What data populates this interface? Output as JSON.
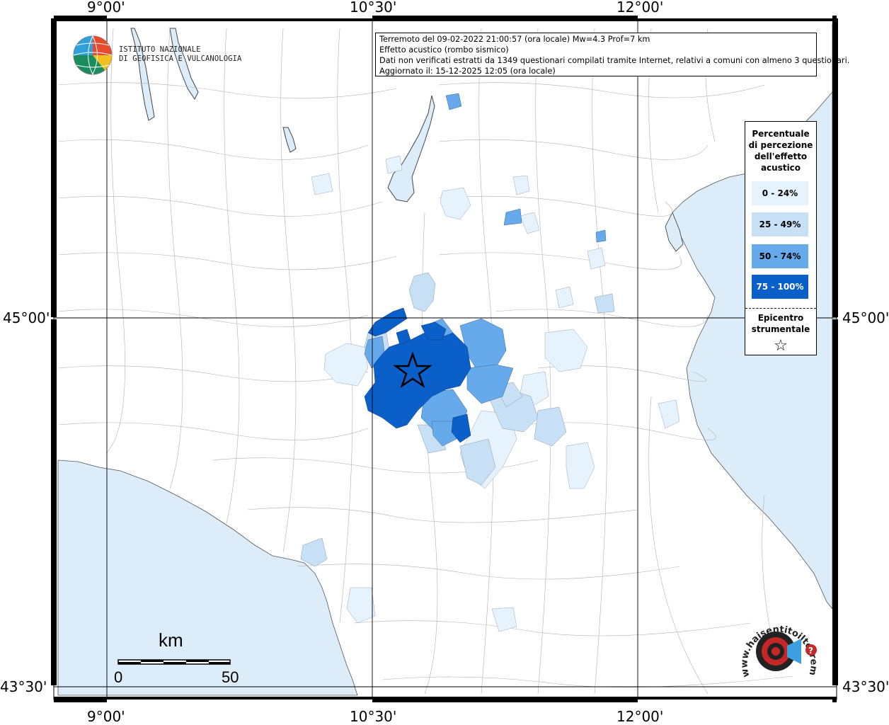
{
  "header": {
    "line1": "Terremoto del 09-02-2022 21:00:57 (ora locale) Mw=4.3 Prof=7 km",
    "line2": "Effetto acustico (rombo sismico)",
    "line3": "Dati non verificati estratti da 1349 questionari compilati tramite Internet, relativi a comuni con almeno 3 questionari.",
    "line4": "Aggiornato il: 15-12-2025 12:05 (ora locale)"
  },
  "logo": {
    "line1": "ISTITUTO NAZIONALE",
    "line2": "DI GEOFISICA E VULCANOLOGIA"
  },
  "axes": {
    "lon_top": [
      "9°00'",
      "10°30'",
      "12°00'"
    ],
    "lon_bottom": [
      "9°00'",
      "10°30'",
      "12°00'"
    ],
    "lat_left": [
      "45°00'",
      "43°30'"
    ],
    "lat_right": [
      "45°00'",
      "43°30'"
    ]
  },
  "legend": {
    "title": "Percentuale di percezione dell'effetto acustico",
    "title_lines": [
      "Percentuale",
      "di percezione",
      "dell'effetto",
      "acustico"
    ],
    "classes": [
      {
        "label": "0 - 24%",
        "color": "#e6f2fc"
      },
      {
        "label": "25 - 49%",
        "color": "#c8e0f6"
      },
      {
        "label": "50 - 74%",
        "color": "#66aaec"
      },
      {
        "label": "75 - 100%",
        "color": "#0a60c8"
      }
    ],
    "epicenter_lines": [
      "Epicentro",
      "strumentale"
    ],
    "epicenter_symbol": "☆"
  },
  "scale": {
    "unit": "km",
    "ticks": [
      "0",
      "50"
    ]
  },
  "brand": {
    "text": "www.haisentitoilterremoto.it"
  },
  "colors": {
    "sea": "#dcecf8",
    "land": "#ffffff",
    "border": "#000000"
  }
}
